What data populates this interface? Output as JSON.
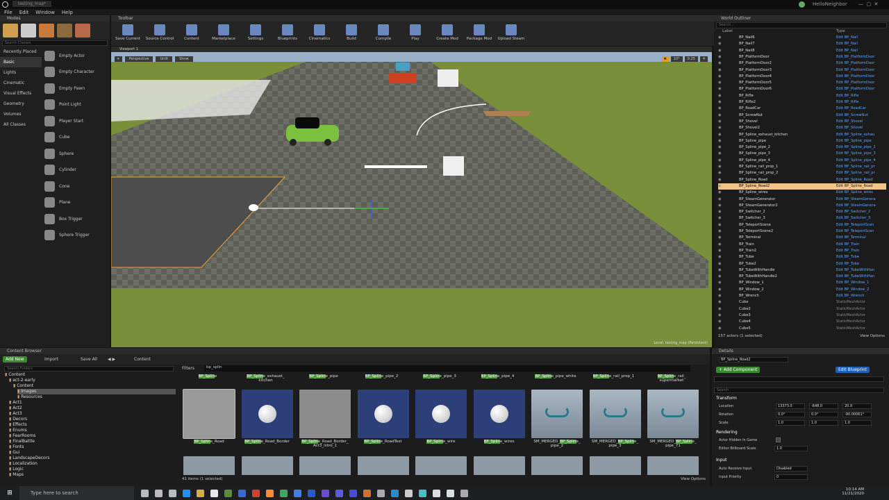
{
  "app": {
    "title": "testing_map*",
    "user": "HelloNeighbor"
  },
  "menu": [
    "File",
    "Edit",
    "Window",
    "Help"
  ],
  "modes": {
    "title": "Modes",
    "search_placeholder": "Search Classes",
    "categories": [
      "Recently Placed",
      "Basic",
      "Lights",
      "Cinematic",
      "Visual Effects",
      "Geometry",
      "Volumes",
      "All Classes"
    ],
    "items": [
      "Empty Actor",
      "Empty Character",
      "Empty Pawn",
      "Point Light",
      "Player Start",
      "Cube",
      "Sphere",
      "Cylinder",
      "Cone",
      "Plane",
      "Box Trigger",
      "Sphere Trigger"
    ]
  },
  "toolbar": {
    "title": "Toolbar",
    "buttons": [
      "Save Current",
      "Source Control",
      "Content",
      "Marketplace",
      "Settings",
      "Blueprints",
      "Cinematics",
      "Build",
      "Compile",
      "Play",
      "Create Mod",
      "Package Mod",
      "Upload Steam"
    ]
  },
  "viewport": {
    "tab": "Viewport 1",
    "perspective": "Perspective",
    "unlit": "Unlit",
    "show": "Show",
    "snap_angle": "10°",
    "snap_scale": "0.25",
    "cam_speed": "4",
    "level_label": "Level:  testing_map (Persistent)"
  },
  "outliner": {
    "title": "World Outliner",
    "search_placeholder": "Search...",
    "col_label": "Label",
    "col_type": "Type",
    "rows": [
      {
        "label": "BP_Nail6",
        "type": "Edit BP_Nail"
      },
      {
        "label": "BP_Nail7",
        "type": "Edit BP_Nail"
      },
      {
        "label": "BP_Nail8",
        "type": "Edit BP_Nail"
      },
      {
        "label": "BP_PlatformDoor",
        "type": "Edit BP_PlatformDoor"
      },
      {
        "label": "BP_PlatformDoor2",
        "type": "Edit BP_PlatformDoor"
      },
      {
        "label": "BP_PlatformDoor3",
        "type": "Edit BP_PlatformDoor"
      },
      {
        "label": "BP_PlatformDoor4",
        "type": "Edit BP_PlatformDoor"
      },
      {
        "label": "BP_PlatformDoor5",
        "type": "Edit BP_PlatformDoor"
      },
      {
        "label": "BP_PlatformDoor6",
        "type": "Edit BP_PlatformDoor"
      },
      {
        "label": "BP_Rifle",
        "type": "Edit BP_Rifle"
      },
      {
        "label": "BP_Rifle2",
        "type": "Edit BP_Rifle"
      },
      {
        "label": "BP_RoadCar",
        "type": "Edit BP_RoadCar"
      },
      {
        "label": "BP_ScrewNut",
        "type": "Edit BP_ScrewNut"
      },
      {
        "label": "BP_Shovel",
        "type": "Edit BP_Shovel"
      },
      {
        "label": "BP_Shovel2",
        "type": "Edit BP_Shovel"
      },
      {
        "label": "BP_Spline_exhaust_kitchen",
        "type": "Edit BP_Spline_exhau"
      },
      {
        "label": "BP_Spline_pipe",
        "type": "Edit BP_Spline_pipe"
      },
      {
        "label": "BP_Spline_pipe_2",
        "type": "Edit BP_Spline_pipe_2"
      },
      {
        "label": "BP_Spline_pipe_3",
        "type": "Edit BP_Spline_pipe_3"
      },
      {
        "label": "BP_Spline_pipe_4",
        "type": "Edit BP_Spline_pipe_4"
      },
      {
        "label": "BP_Spline_rail_prop_1",
        "type": "Edit BP_Spline_rail_pr"
      },
      {
        "label": "BP_Spline_rail_prop_2",
        "type": "Edit BP_Spline_rail_pr"
      },
      {
        "label": "BP_Spline_Road",
        "type": "Edit BP_Spline_Road"
      },
      {
        "label": "BP_Spline_Road2",
        "type": "Edit BP_Spline_Road",
        "selected": true
      },
      {
        "label": "BP_Spline_wires",
        "type": "Edit BP_Spline_wires"
      },
      {
        "label": "BP_SteamGenerator",
        "type": "Edit BP_SteamGenera"
      },
      {
        "label": "BP_SteamGenerator2",
        "type": "Edit BP_SteamGenera"
      },
      {
        "label": "BP_Switcher_2",
        "type": "Edit BP_Switcher_2"
      },
      {
        "label": "BP_Switcher_3",
        "type": "Edit BP_Switcher_3"
      },
      {
        "label": "BP_TeleportScene",
        "type": "Edit BP_TeleportScen"
      },
      {
        "label": "BP_TeleportScene2",
        "type": "Edit BP_TeleportScen"
      },
      {
        "label": "BP_Terminal",
        "type": "Edit BP_Terminal"
      },
      {
        "label": "BP_Train",
        "type": "Edit BP_Train"
      },
      {
        "label": "BP_Train2",
        "type": "Edit BP_Train"
      },
      {
        "label": "BP_Tube",
        "type": "Edit BP_Tube"
      },
      {
        "label": "BP_Tube2",
        "type": "Edit BP_Tube"
      },
      {
        "label": "BP_TubeWithHandle",
        "type": "Edit BP_TubeWithHan"
      },
      {
        "label": "BP_TubeWithHandle2",
        "type": "Edit BP_TubeWithHan"
      },
      {
        "label": "BP_Window_1",
        "type": "Edit BP_Window_1"
      },
      {
        "label": "BP_Window_2",
        "type": "Edit BP_Window_2"
      },
      {
        "label": "BP_Wrench",
        "type": "Edit BP_Wrench"
      },
      {
        "label": "Cube",
        "type": "StaticMeshActor",
        "static": true
      },
      {
        "label": "Cube2",
        "type": "StaticMeshActor",
        "static": true
      },
      {
        "label": "Cube3",
        "type": "StaticMeshActor",
        "static": true
      },
      {
        "label": "Cube4",
        "type": "StaticMeshActor",
        "static": true
      },
      {
        "label": "Cube5",
        "type": "StaticMeshActor",
        "static": true
      }
    ],
    "footer": "157 actors (1 selected)",
    "view_options": "View Options"
  },
  "content_browser": {
    "title": "Content Browser",
    "add_new": "Add New",
    "import": "Import",
    "save_all": "Save All",
    "path": "Content",
    "folder_search_placeholder": "Search Folders",
    "filters": "Filters",
    "search_value": "bp_splin",
    "folders": [
      "Content",
      "act-2-early",
      "Content",
      "Images",
      "Resources",
      "Act1",
      "Act2",
      "Act3",
      "Decors",
      "Effects",
      "Enums",
      "FearRooms",
      "FinalBattle",
      "Fonts",
      "Gui",
      "LandscapeDecors",
      "Localization",
      "Logic",
      "Maps"
    ],
    "top_labels": [
      {
        "pre": "",
        "hl": "BP_Splin",
        "post": "e"
      },
      {
        "pre": "",
        "hl": "BP_Splin",
        "post": "e_exhaust_ kitchen"
      },
      {
        "pre": "",
        "hl": "BP_Splin",
        "post": "e_pipe"
      },
      {
        "pre": "",
        "hl": "BP_Splin",
        "post": "e_pipe_2"
      },
      {
        "pre": "",
        "hl": "BP_Splin",
        "post": "e_pipe_3"
      },
      {
        "pre": "",
        "hl": "BP_Splin",
        "post": "e_pipe_4"
      },
      {
        "pre": "",
        "hl": "BP_Splin",
        "post": "e_pipe_white"
      },
      {
        "pre": "",
        "hl": "BP_Splin",
        "post": "e_rail_prop_1"
      },
      {
        "pre": "",
        "hl": "BP_Splin",
        "post": "e_rail_ supermarket"
      }
    ],
    "assets": [
      {
        "pre": "",
        "hl": "BP_Splin",
        "post": "e_Road",
        "kind": "plane"
      },
      {
        "pre": "",
        "hl": "BP_Splin",
        "post": "e_Road_Border",
        "kind": "sphere"
      },
      {
        "pre": "",
        "hl": "BP_Splin",
        "post": "e_Road_Border_ Act3_intro_1",
        "kind": "grey"
      },
      {
        "pre": "",
        "hl": "BP_Splin",
        "post": "e_RoadTest",
        "kind": "sphere"
      },
      {
        "pre": "",
        "hl": "BP_Splin",
        "post": "e_wire",
        "kind": "sphere"
      },
      {
        "pre": "",
        "hl": "BP_Splin",
        "post": "e_wires",
        "kind": "sphere"
      },
      {
        "pre": "SM_MERGED_",
        "hl": "BP_Splin",
        "post": "e_ pipe_2",
        "kind": "mesh"
      },
      {
        "pre": "SM_MERGED_",
        "hl": "BP_Splin",
        "post": "e_ pipe_3",
        "kind": "mesh"
      },
      {
        "pre": "SM_MERGED_",
        "hl": "BP_Splin",
        "post": "e_ pipe_71",
        "kind": "mesh"
      }
    ],
    "footer": "41 items (1 selected)",
    "view_options": "View Options"
  },
  "details": {
    "title": "Details",
    "object_name": "BP_Spline_Road2",
    "add_component": "+ Add Component",
    "edit_blueprint": "Edit Blueprint",
    "search_placeholder": "Search",
    "transform": "Transform",
    "location_label": "Location",
    "location": [
      "13373.0",
      "-648.0",
      "20.0"
    ],
    "rotation_label": "Rotation",
    "rotation": [
      "0.0°",
      "0.0°",
      "-90.00061°"
    ],
    "scale_label": "Scale",
    "scale": [
      "1.0",
      "1.0",
      "1.0"
    ],
    "rendering": "Rendering",
    "hidden_label": "Actor Hidden In Game",
    "billboard_label": "Editor Billboard Scale",
    "billboard_value": "1.0",
    "input": "Input",
    "auto_receive_label": "Auto Receive Input",
    "auto_receive_value": "Disabled",
    "input_priority_label": "Input Priority",
    "input_priority_value": "0"
  },
  "taskbar": {
    "search_placeholder": "Type here to search",
    "time": "10:14 AM",
    "date": "11/21/2020"
  },
  "colors": {
    "accent": "#f2c488",
    "link": "#5aa6ff",
    "green": "#3a8a2f",
    "blue": "#1e5fb8"
  }
}
